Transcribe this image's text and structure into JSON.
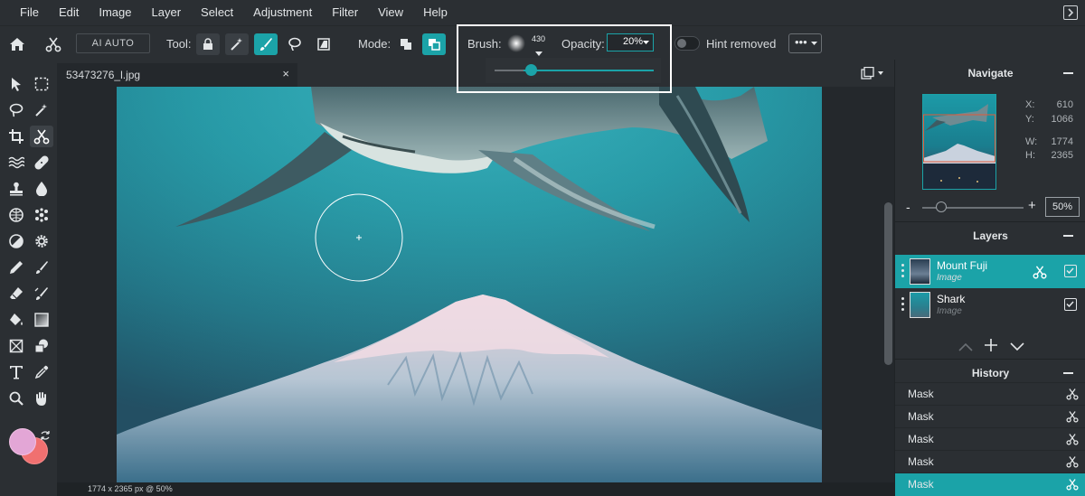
{
  "menu": [
    "File",
    "Edit",
    "Image",
    "Layer",
    "Select",
    "Adjustment",
    "Filter",
    "View",
    "Help"
  ],
  "toolbar": {
    "ai_auto": "AI AUTO",
    "tool_label": "Tool:",
    "mode_label": "Mode:",
    "brush_label": "Brush:",
    "brush_size": "430",
    "opacity_label": "Opacity:",
    "opacity_value": "20%",
    "hint_label": "Hint removed",
    "more": "•••",
    "accent": "#1ba3a8"
  },
  "document": {
    "tab_title": "53473276_l.jpg",
    "close": "×",
    "status": "1774 x 2365 px @ 50%"
  },
  "navigate": {
    "title": "Navigate",
    "x_label": "X:",
    "x_value": "610",
    "y_label": "Y:",
    "y_value": "1066",
    "w_label": "W:",
    "w_value": "1774",
    "h_label": "H:",
    "h_value": "2365",
    "zoom": "50%",
    "minus": "-",
    "plus": "+"
  },
  "layers": {
    "title": "Layers",
    "items": [
      {
        "name": "Mount Fuji",
        "type": "Image",
        "active": true
      },
      {
        "name": "Shark",
        "type": "Image",
        "active": false
      }
    ]
  },
  "history": {
    "title": "History",
    "items": [
      "Mask",
      "Mask",
      "Mask",
      "Mask",
      "Mask"
    ],
    "active_index": 4
  },
  "colors": {
    "primary": "#e3a6d6",
    "secondary": "#f07070"
  }
}
